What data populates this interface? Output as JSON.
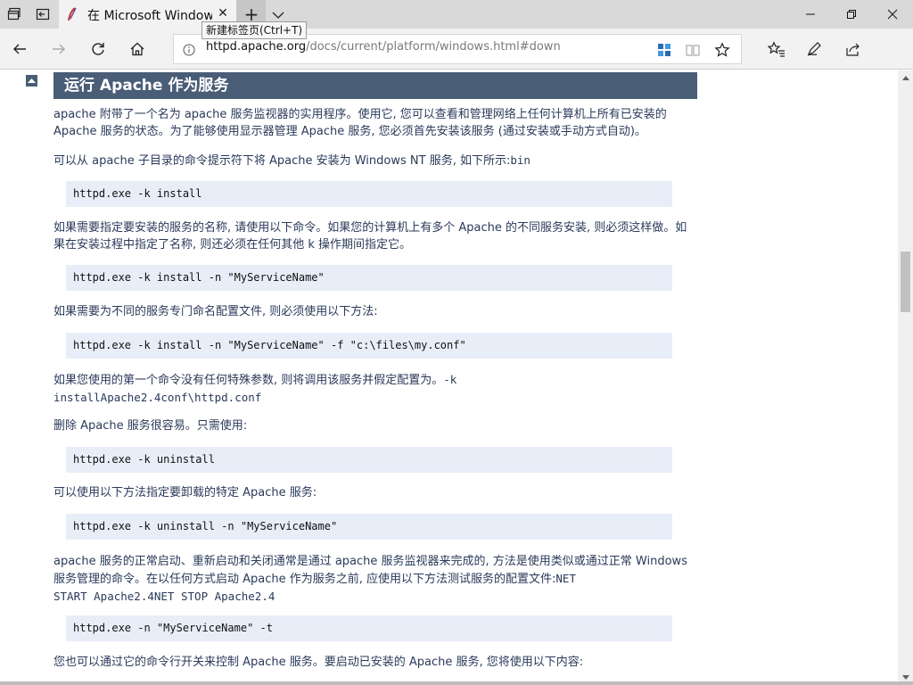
{
  "browser": {
    "tab_title": "在 Microsoft Windows上",
    "tooltip": "新建标签页(Ctrl+T)",
    "url_domain": "httpd.apache.org",
    "url_path": "/docs/current/platform/windows.html#down"
  },
  "icons": [
    "tab-manager-icon",
    "set-aside-icon",
    "apache-feather-icon",
    "close-icon",
    "plus-icon",
    "chevron-down-icon",
    "minimize-icon",
    "maximize-icon",
    "close-window-icon",
    "back-icon",
    "forward-icon",
    "refresh-icon",
    "home-icon",
    "info-icon",
    "extension-icon",
    "reading-view-icon",
    "star-icon",
    "favorites-icon",
    "pen-icon",
    "share-icon",
    "arrow-up-icon"
  ],
  "colors": {
    "header_bg": "#4a5d77",
    "code_bg": "#e8eef8",
    "text": "#2a3a5a"
  },
  "doc": {
    "heading": "运行 Apache 作为服务",
    "p1": "apache 附带了一个名为 apache 服务监视器的实用程序。使用它, 您可以查看和管理网络上任何计算机上所有已安装的 Apache 服务的状态。为了能够使用显示器管理 Apache 服务, 您必须首先安装该服务 (通过安装或手动方式自动)。",
    "p2_text": "可以从 apache 子目录的命令提示符下将 Apache 安装为 Windows NT 服务, 如下所示:",
    "p2_code": "bin",
    "code1": "httpd.exe -k install",
    "p3": "如果需要指定要安装的服务的名称, 请使用以下命令。如果您的计算机上有多个 Apache 的不同服务安装, 则必须这样做。如果在安装过程中指定了名称, 则还必须在任何其他 k 操作期间指定它。",
    "code2": "httpd.exe -k install -n \"MyServiceName\"",
    "p4": "如果需要为不同的服务专门命名配置文件, 则必须使用以下方法:",
    "code3": "httpd.exe -k install -n \"MyServiceName\" -f \"c:\\files\\my.conf\"",
    "p5_text": "如果您使用的第一个命令没有任何特殊参数, 则将调用该服务并假定配置为。",
    "p5_code_a": "-k",
    "p5_code_b": "installApache2.4conf\\httpd.conf",
    "p6": "删除 Apache 服务很容易。只需使用:",
    "code4": "httpd.exe -k uninstall",
    "p7": "可以使用以下方法指定要卸载的特定 Apache 服务:",
    "code5": "httpd.exe -k uninstall -n \"MyServiceName\"",
    "p8_text": "apache 服务的正常启动、重新启动和关闭通常是通过 apache 服务监视器来完成的, 方法是使用类似或通过正常 Windows 服务管理的命令。在以任何方式启动 Apache 作为服务之前, 应使用以下方法测试服务的配置文件:",
    "p8_code_a": "NET",
    "p8_code_b": "START Apache2.4NET STOP Apache2.4",
    "code6": "httpd.exe -n \"MyServiceName\" -t",
    "p9": "您也可以通过它的命令行开关来控制 Apache 服务。要启动已安装的 Apache 服务, 您将使用以下内容:"
  }
}
